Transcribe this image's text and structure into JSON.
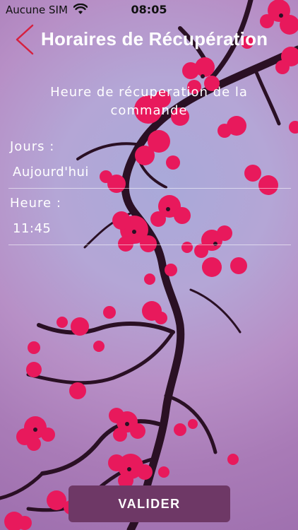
{
  "status_bar": {
    "carrier": "Aucune SIM",
    "time": "08:05"
  },
  "nav": {
    "title": "Horaires de Récupération"
  },
  "form": {
    "subtitle": "Heure de récuperation de la commande",
    "days_label": "Jours :",
    "days_value": "Aujourd'hui",
    "hour_label": "Heure :",
    "hour_value": "11:45"
  },
  "actions": {
    "submit_label": "VALIDER"
  },
  "colors": {
    "accent": "#d6203f",
    "button": "#6e3866",
    "blossom": "#e8195c",
    "branch": "#2a1024"
  }
}
